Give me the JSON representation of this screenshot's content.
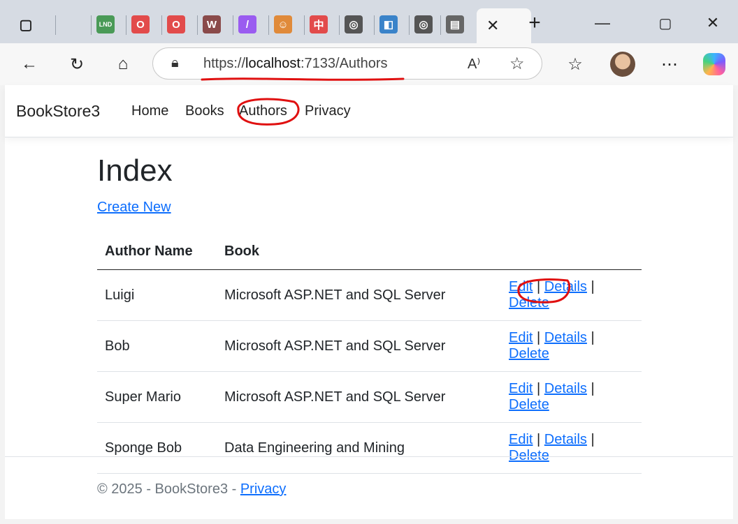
{
  "browser": {
    "url_scheme": "https://",
    "url_host": "localhost",
    "url_rest": ":7133/Authors",
    "tab_icons": [
      {
        "name": "tab-actions-icon"
      },
      {
        "name": "tab-page-icon"
      },
      {
        "name": "tab-lnd-icon",
        "text": "LND",
        "color": "#4a9a57"
      },
      {
        "name": "tab-opera-icon",
        "text": "O",
        "color": "#e24b4b"
      },
      {
        "name": "tab-opera2-icon",
        "text": "O",
        "color": "#e24b4b"
      },
      {
        "name": "tab-w-icon",
        "text": "W",
        "color": "#8a4a4a"
      },
      {
        "name": "tab-pen-icon",
        "text": "/",
        "color": "#9a5cf0"
      },
      {
        "name": "tab-face-icon",
        "text": "☺",
        "color": "#e08a3a"
      },
      {
        "name": "tab-zhong-icon",
        "text": "中",
        "color": "#e24b4b"
      },
      {
        "name": "tab-globe-icon",
        "text": "◎",
        "color": "#555"
      },
      {
        "name": "tab-app-icon",
        "text": "◧",
        "color": "#3a83c9"
      },
      {
        "name": "tab-globe2-icon",
        "text": "◎",
        "color": "#555"
      },
      {
        "name": "tab-doc-icon",
        "text": "▤",
        "color": "#666"
      }
    ]
  },
  "app": {
    "brand": "BookStore3",
    "nav": [
      "Home",
      "Books",
      "Authors",
      "Privacy"
    ]
  },
  "main": {
    "title": "Index",
    "create_link": "Create New",
    "columns": [
      "Author Name",
      "Book"
    ],
    "rows": [
      {
        "author": "Luigi",
        "book": "Microsoft ASP.NET and SQL Server"
      },
      {
        "author": "Bob",
        "book": "Microsoft ASP.NET and SQL Server"
      },
      {
        "author": "Super Mario",
        "book": "Microsoft ASP.NET and SQL Server"
      },
      {
        "author": "Sponge Bob",
        "book": "Data Engineering and Mining"
      }
    ],
    "actions": {
      "edit": "Edit",
      "details": "Details",
      "delete": "Delete",
      "separator": "|"
    }
  },
  "footer": {
    "text": "© 2025 - BookStore3 - ",
    "privacy": "Privacy"
  },
  "colors": {
    "link": "#0d6efd",
    "annotation": "#e01010"
  }
}
